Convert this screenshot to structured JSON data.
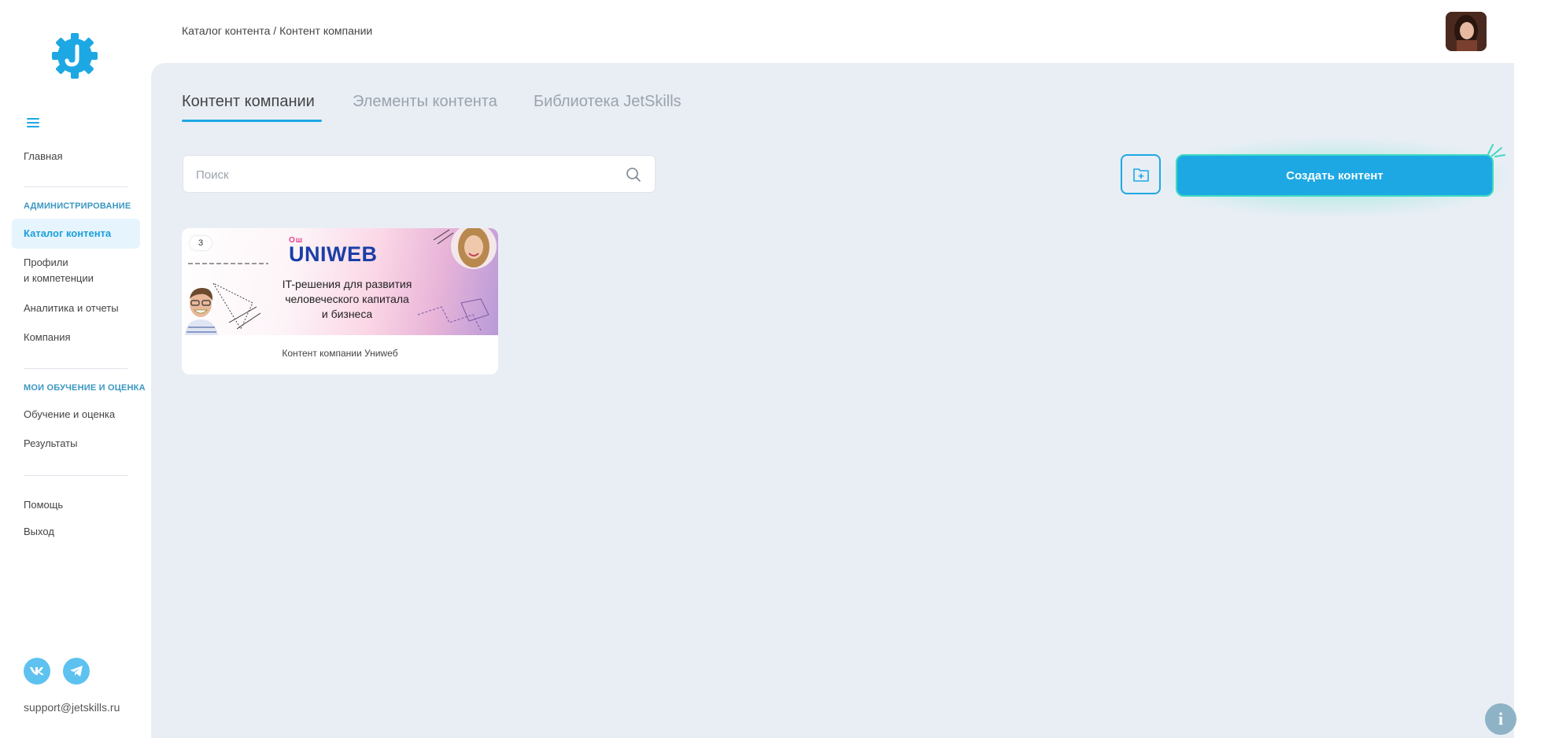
{
  "breadcrumb": "Каталог контента / Контент компании",
  "sidebar": {
    "home": "Главная",
    "section_admin": "АДМИНИСТРИРОВАНИЕ",
    "catalog": "Каталог контента",
    "profiles_line1": "Профили",
    "profiles_line2": "и компетенции",
    "analytics": "Аналитика и отчеты",
    "company": "Компания",
    "section_learning": "МОИ ОБУЧЕНИЕ И ОЦЕНКА",
    "learning": "Обучение и оценка",
    "results": "Результаты",
    "help": "Помощь",
    "logout": "Выход",
    "support_email": "support@jetskills.ru"
  },
  "tabs": [
    {
      "label": "Контент компании"
    },
    {
      "label": "Элементы контента"
    },
    {
      "label": "Библиотека JetSkills"
    }
  ],
  "search": {
    "placeholder": "Поиск"
  },
  "create_button": "Создать контент",
  "card": {
    "badge": "3",
    "brand_sup": "Ош",
    "brand": "UNIWEB",
    "headline_1": "IT-решения для развития",
    "headline_2": "человеческого капитала",
    "headline_3": "и бизнеса",
    "caption": "Контент компании Униweб"
  },
  "info_label": "i",
  "colors": {
    "accent": "#1da8e4",
    "glow": "#3ed9c0",
    "panel": "#e9eef5"
  }
}
